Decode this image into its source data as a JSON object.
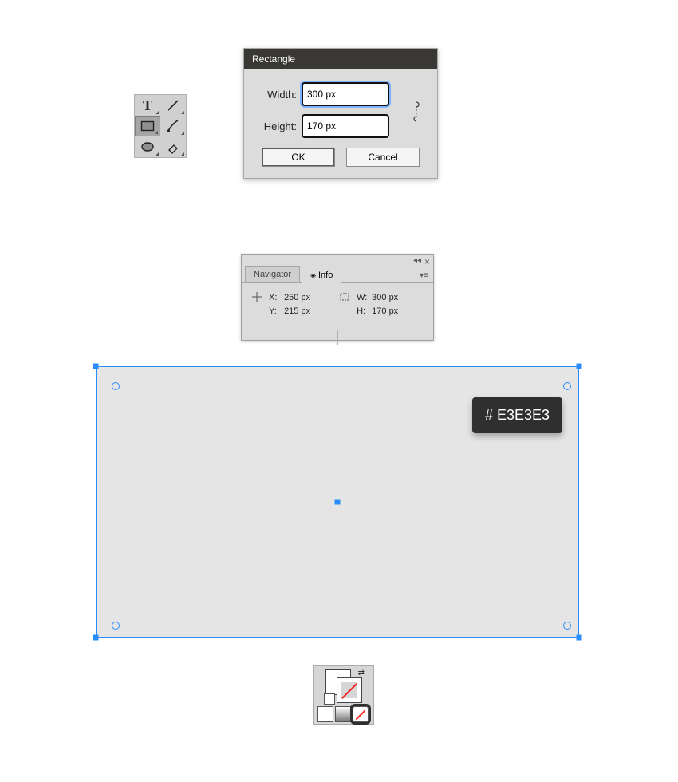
{
  "tools": [
    "type-tool",
    "line-segment-tool",
    "rectangle-tool",
    "paintbrush-tool",
    "ellipse-tool",
    "eraser-tool"
  ],
  "dialog": {
    "title": "Rectangle",
    "width_label": "Width:",
    "height_label": "Height:",
    "width_value": "300 px",
    "height_value": "170 px",
    "ok_label": "OK",
    "cancel_label": "Cancel"
  },
  "panel": {
    "tab_navigator": "Navigator",
    "tab_info": "Info",
    "x_label": "X:",
    "y_label": "Y:",
    "x_value": "250 px",
    "y_value": "215 px",
    "w_label": "W:",
    "h_label": "H:",
    "w_value": "300 px",
    "h_value": "170 px"
  },
  "canvas": {
    "fill_hex": "# E3E3E3"
  }
}
